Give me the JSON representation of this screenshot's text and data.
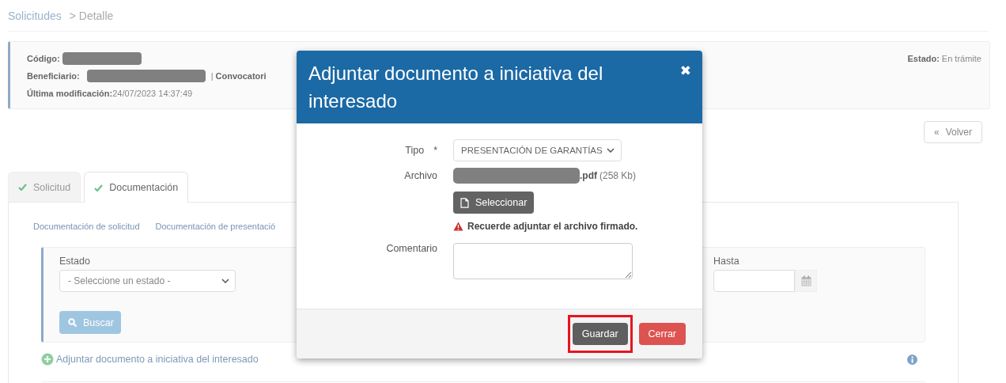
{
  "breadcrumb": [
    {
      "label": "Solicitudes",
      "kind": "link"
    },
    {
      "label": "> Detalle",
      "kind": "current"
    }
  ],
  "summary": {
    "code_label": "Código:",
    "code_redacted": true,
    "beneficiary_label": "Beneficiario:",
    "beneficiary_redacted": true,
    "separator": "|",
    "call_label": "Convocatori",
    "modified_label": "Última modificación:",
    "modified_value": "24/07/2023 14:37:49",
    "status_label": "Estado:",
    "status_value": "En trámite"
  },
  "back_button": {
    "icon": "«",
    "label": "Volver"
  },
  "tabs": [
    {
      "label": "Solicitud",
      "done": true,
      "selected": false
    },
    {
      "label": "Documentación",
      "done": true,
      "selected": true
    }
  ],
  "subtabs": [
    "Documentación de solicitud",
    "Documentación de presentació"
  ],
  "filters": {
    "status_label": "Estado",
    "status_placeholder": "- Seleccione un estado -",
    "until_label": "Hasta",
    "search_button": "Buscar"
  },
  "add_link": "Adjuntar documento a iniciativa del interesado",
  "modal": {
    "title": "Adjuntar documento a iniciativa del interesado",
    "close": "✖",
    "fields": [
      {
        "kind": "select",
        "label": "Tipo",
        "required_mark": "*",
        "value": "PRESENTACIÓN DE GARANTÍAS"
      },
      {
        "kind": "file",
        "label": "Archivo",
        "file_redacted": true,
        "extension": ".pdf",
        "size": "(258 Kb)",
        "button": "Seleccionar",
        "warning": "Recuerde adjuntar el archivo firmado."
      },
      {
        "kind": "textarea",
        "label": "Comentario"
      }
    ],
    "buttons": [
      {
        "label": "Guardar",
        "kind": "default",
        "highlighted": true
      },
      {
        "label": "Cerrar",
        "kind": "danger",
        "highlighted": false
      }
    ]
  }
}
